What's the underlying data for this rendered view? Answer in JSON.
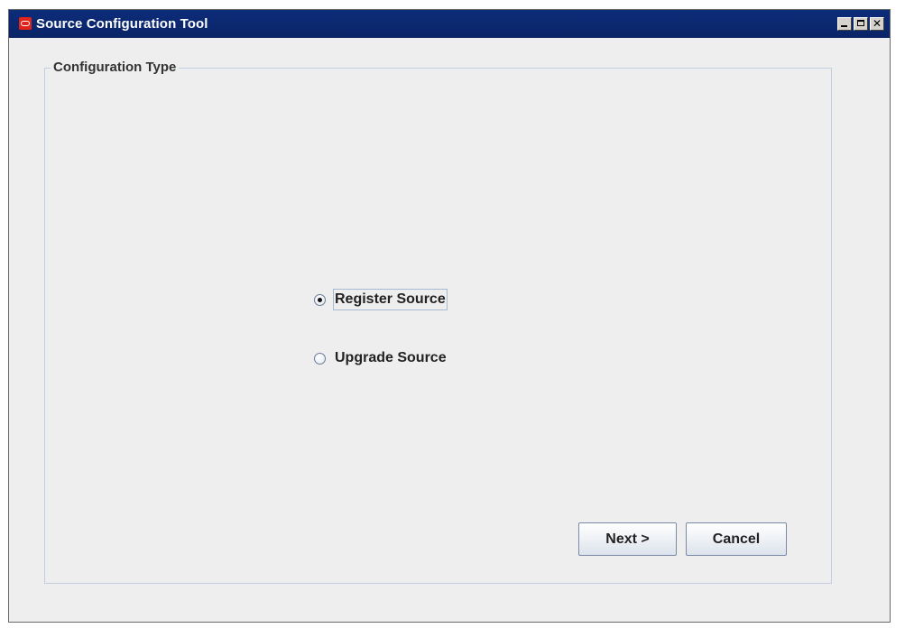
{
  "window": {
    "title": "Source Configuration Tool",
    "controls": {
      "minimize": "minimize",
      "maximize": "maximize",
      "close": "✕"
    }
  },
  "group": {
    "label": "Configuration Type"
  },
  "options": [
    {
      "label": "Register Source",
      "selected": true
    },
    {
      "label": "Upgrade Source",
      "selected": false
    }
  ],
  "buttons": {
    "next": "Next >",
    "cancel": "Cancel"
  },
  "colors": {
    "titlebar": "#0a2466",
    "app_icon": "#e2231a",
    "group_border": "#c3cfe0",
    "window_bg": "#eeeeee"
  }
}
